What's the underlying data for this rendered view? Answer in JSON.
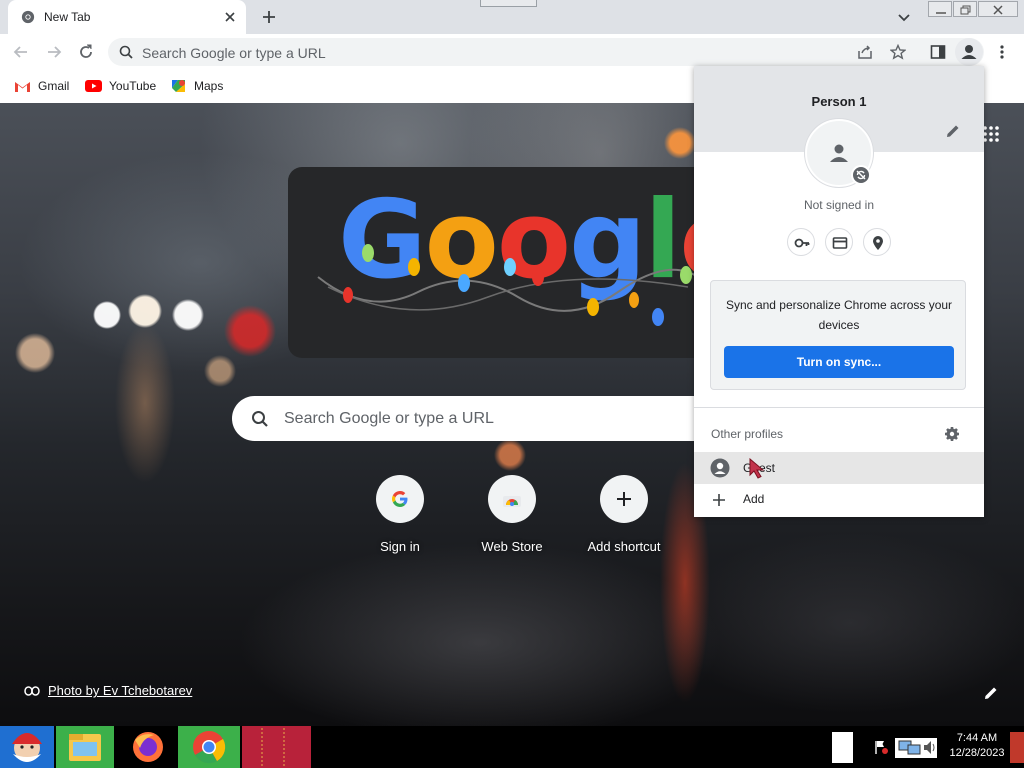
{
  "tab": {
    "title": "New Tab"
  },
  "omnibox": {
    "placeholder": "Search Google or type a URL"
  },
  "bookmarks": [
    {
      "label": "Gmail",
      "icon": "gmail-icon"
    },
    {
      "label": "YouTube",
      "icon": "youtube-icon"
    },
    {
      "label": "Maps",
      "icon": "maps-icon"
    }
  ],
  "ntp": {
    "doodle_text": "Google",
    "search_placeholder": "Search Google or type a URL",
    "shortcuts": [
      {
        "label": "Sign in",
        "icon": "google-g-icon"
      },
      {
        "label": "Web Store",
        "icon": "web-store-icon"
      },
      {
        "label": "Add shortcut",
        "icon": "plus-icon"
      }
    ],
    "photo_credit": "Photo by Ev Tchebotarev"
  },
  "profile_menu": {
    "name": "Person 1",
    "status": "Not signed in",
    "sync_promo": "Sync and personalize Chrome across your devices",
    "sync_button": "Turn on sync...",
    "other_profiles_label": "Other profiles",
    "guest_label": "Guest",
    "add_label": "Add"
  },
  "taskbar": {
    "time": "7:44 AM",
    "date": "12/28/2023"
  },
  "colors": {
    "accent": "#1a73e8",
    "tabstrip": "#dee1e6",
    "menu_header": "#e3e5e8"
  }
}
